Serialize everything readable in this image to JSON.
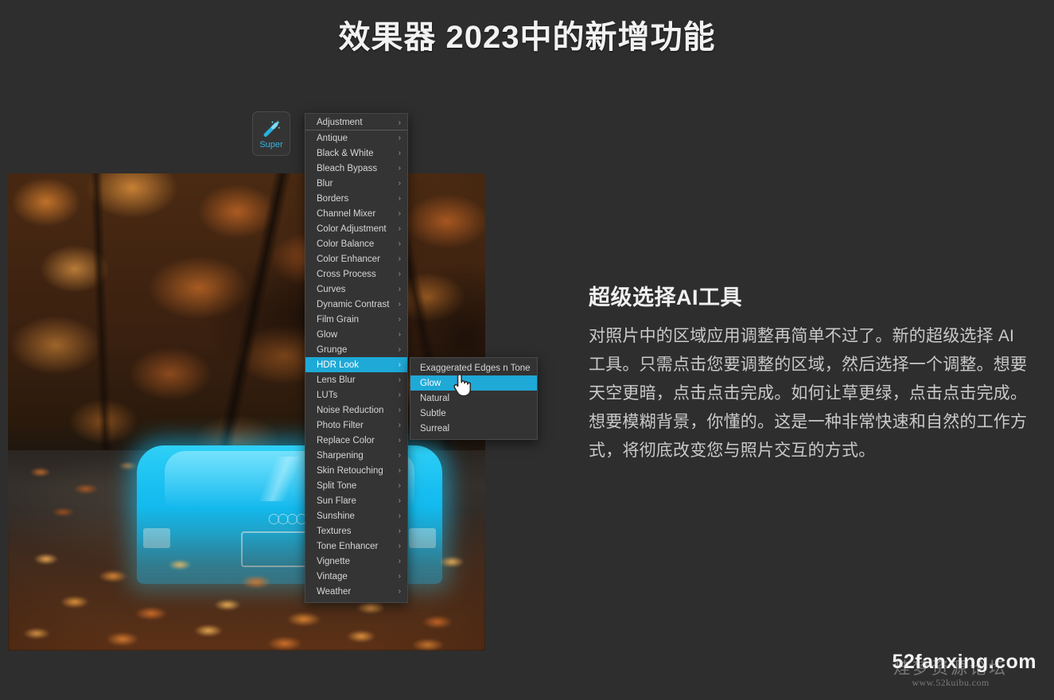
{
  "page": {
    "title": "效果器 2023中的新增功能",
    "background_color": "#2e2e2e"
  },
  "toolbar": {
    "super_tool": {
      "label": "Super",
      "icon": "magic-wand-icon",
      "accent_color": "#33b6e0"
    }
  },
  "effects_menu": {
    "highlight_color": "#1fa9d6",
    "items": [
      {
        "label": "Adjustment",
        "chevron": "›",
        "separator_after": true,
        "selected": false
      },
      {
        "label": "Antique",
        "chevron": "›",
        "separator_after": false,
        "selected": false
      },
      {
        "label": "Black & White",
        "chevron": "›",
        "separator_after": false,
        "selected": false
      },
      {
        "label": "Bleach Bypass",
        "chevron": "›",
        "separator_after": false,
        "selected": false
      },
      {
        "label": "Blur",
        "chevron": "›",
        "separator_after": false,
        "selected": false
      },
      {
        "label": "Borders",
        "chevron": "›",
        "separator_after": false,
        "selected": false
      },
      {
        "label": "Channel Mixer",
        "chevron": "›",
        "separator_after": false,
        "selected": false
      },
      {
        "label": "Color Adjustment",
        "chevron": "›",
        "separator_after": false,
        "selected": false
      },
      {
        "label": "Color Balance",
        "chevron": "›",
        "separator_after": false,
        "selected": false
      },
      {
        "label": "Color Enhancer",
        "chevron": "›",
        "separator_after": false,
        "selected": false
      },
      {
        "label": "Cross Process",
        "chevron": "›",
        "separator_after": false,
        "selected": false
      },
      {
        "label": "Curves",
        "chevron": "›",
        "separator_after": false,
        "selected": false
      },
      {
        "label": "Dynamic Contrast",
        "chevron": "›",
        "separator_after": false,
        "selected": false
      },
      {
        "label": "Film Grain",
        "chevron": "›",
        "separator_after": false,
        "selected": false
      },
      {
        "label": "Glow",
        "chevron": "›",
        "separator_after": false,
        "selected": false
      },
      {
        "label": "Grunge",
        "chevron": "›",
        "separator_after": false,
        "selected": false
      },
      {
        "label": "HDR Look",
        "chevron": "›",
        "separator_after": false,
        "selected": true
      },
      {
        "label": "Lens Blur",
        "chevron": "›",
        "separator_after": false,
        "selected": false
      },
      {
        "label": "LUTs",
        "chevron": "›",
        "separator_after": false,
        "selected": false
      },
      {
        "label": "Noise Reduction",
        "chevron": "›",
        "separator_after": false,
        "selected": false
      },
      {
        "label": "Photo Filter",
        "chevron": "›",
        "separator_after": false,
        "selected": false
      },
      {
        "label": "Replace Color",
        "chevron": "›",
        "separator_after": false,
        "selected": false
      },
      {
        "label": "Sharpening",
        "chevron": "›",
        "separator_after": false,
        "selected": false
      },
      {
        "label": "Skin Retouching",
        "chevron": "›",
        "separator_after": false,
        "selected": false
      },
      {
        "label": "Split Tone",
        "chevron": "›",
        "separator_after": false,
        "selected": false
      },
      {
        "label": "Sun Flare",
        "chevron": "›",
        "separator_after": false,
        "selected": false
      },
      {
        "label": "Sunshine",
        "chevron": "›",
        "separator_after": false,
        "selected": false
      },
      {
        "label": "Textures",
        "chevron": "›",
        "separator_after": false,
        "selected": false
      },
      {
        "label": "Tone Enhancer",
        "chevron": "›",
        "separator_after": false,
        "selected": false
      },
      {
        "label": "Vignette",
        "chevron": "›",
        "separator_after": false,
        "selected": false
      },
      {
        "label": "Vintage",
        "chevron": "›",
        "separator_after": false,
        "selected": false
      },
      {
        "label": "Weather",
        "chevron": "›",
        "separator_after": false,
        "selected": false
      }
    ]
  },
  "submenu": {
    "parent": "HDR Look",
    "items": [
      {
        "label": "Exaggerated Edges n Tone",
        "selected": false
      },
      {
        "label": "Glow",
        "selected": true
      },
      {
        "label": "Natural",
        "selected": false
      },
      {
        "label": "Subtle",
        "selected": false
      },
      {
        "label": "Surreal",
        "selected": false
      }
    ]
  },
  "photo": {
    "description": "autumn-forest-road-with-selected-car",
    "selection_color": "#16bdf0"
  },
  "cursor": {
    "type": "pointing-hand"
  },
  "feature": {
    "heading": "超级选择AI工具",
    "body": "对照片中的区域应用调整再简单不过了。新的超级选择 AI 工具。只需点击您要调整的区域，然后选择一个调整。想要天空更暗，点击点击完成。如何让草更绿，点击点击完成。想要模糊背景，你懂的。这是一种非常快速和自然的工作方式，将彻底改变您与照片交互的方式。"
  },
  "watermark": {
    "main": "52fanxing.com",
    "overlay_cn": "烓梦资源论坛",
    "overlay_url": "www.52kuibu.com"
  }
}
